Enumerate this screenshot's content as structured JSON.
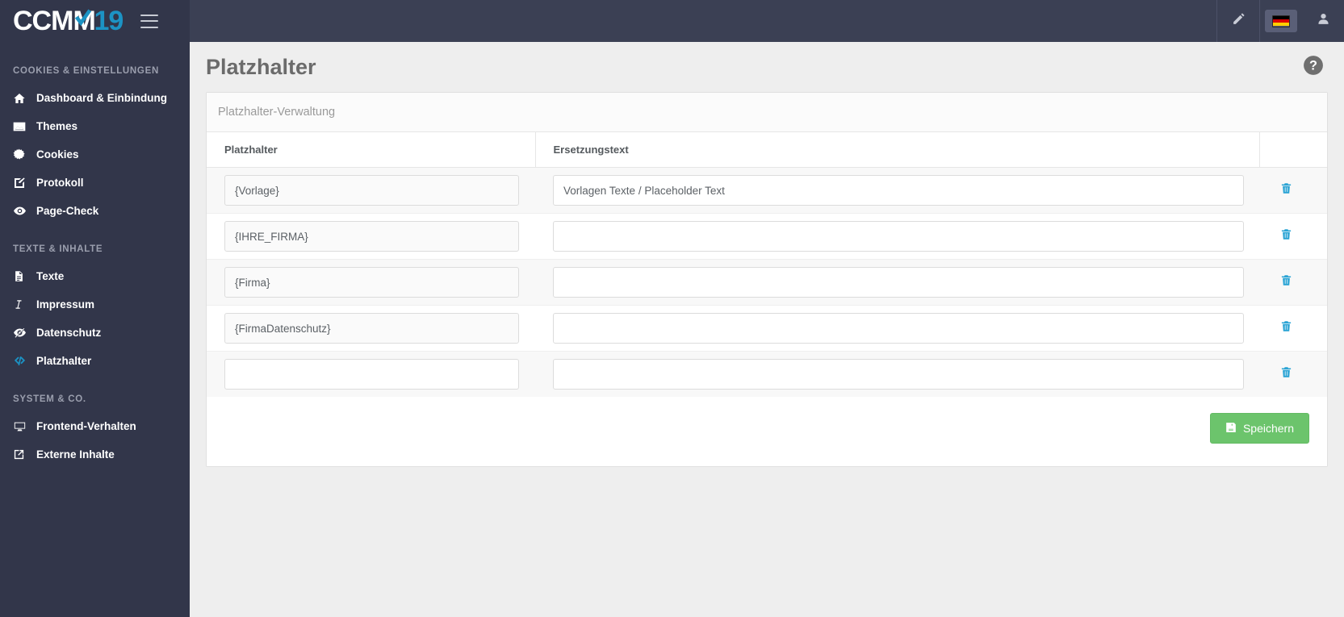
{
  "brand": {
    "logo_white": "CCM",
    "logo_m": "M",
    "logo_blue": "19",
    "accent_color": "#1c93c4"
  },
  "topbar": {
    "edit_icon": "pencil-icon",
    "language_flag": "german-flag-icon",
    "user_icon": "user-icon"
  },
  "sidebar": {
    "sections": [
      {
        "title": "COOKIES & EINSTELLUNGEN",
        "items": [
          {
            "label": "Dashboard & Einbindung",
            "icon": "home-icon",
            "active": false
          },
          {
            "label": "Themes",
            "icon": "image-icon",
            "active": false
          },
          {
            "label": "Cookies",
            "icon": "cookie-icon",
            "active": false
          },
          {
            "label": "Protokoll",
            "icon": "edit-square-icon",
            "active": false
          },
          {
            "label": "Page-Check",
            "icon": "eye-icon",
            "active": false
          }
        ]
      },
      {
        "title": "TEXTE & INHALTE",
        "items": [
          {
            "label": "Texte",
            "icon": "document-icon",
            "active": false
          },
          {
            "label": "Impressum",
            "icon": "italic-icon",
            "active": false
          },
          {
            "label": "Datenschutz",
            "icon": "eye-slash-icon",
            "active": false
          },
          {
            "label": "Platzhalter",
            "icon": "code-icon",
            "active": true
          }
        ]
      },
      {
        "title": "SYSTEM & CO.",
        "items": [
          {
            "label": "Frontend-Verhalten",
            "icon": "desktop-icon",
            "active": false
          },
          {
            "label": "Externe Inhalte",
            "icon": "external-link-icon",
            "active": false
          }
        ]
      }
    ]
  },
  "page": {
    "title": "Platzhalter",
    "help_icon": "question-circle-icon"
  },
  "card": {
    "header": "Platzhalter-Verwaltung",
    "columns": {
      "placeholder": "Platzhalter",
      "replacement": "Ersetzungstext",
      "actions": ""
    },
    "rows": [
      {
        "placeholder": "{Vorlage}",
        "replacement": "Vorlagen Texte / Placeholder Text",
        "delete_icon": "trash-icon"
      },
      {
        "placeholder": "{IHRE_FIRMA}",
        "replacement": "",
        "delete_icon": "trash-icon"
      },
      {
        "placeholder": "{Firma}",
        "replacement": "",
        "delete_icon": "trash-icon"
      },
      {
        "placeholder": "{FirmaDatenschutz}",
        "replacement": "",
        "delete_icon": "trash-icon"
      },
      {
        "placeholder": "",
        "replacement": "",
        "delete_icon": "trash-icon"
      }
    ],
    "save_label": "Speichern",
    "save_icon": "floppy-save-icon",
    "save_color": "#6cc46c",
    "trash_color": "#29a3d4"
  }
}
